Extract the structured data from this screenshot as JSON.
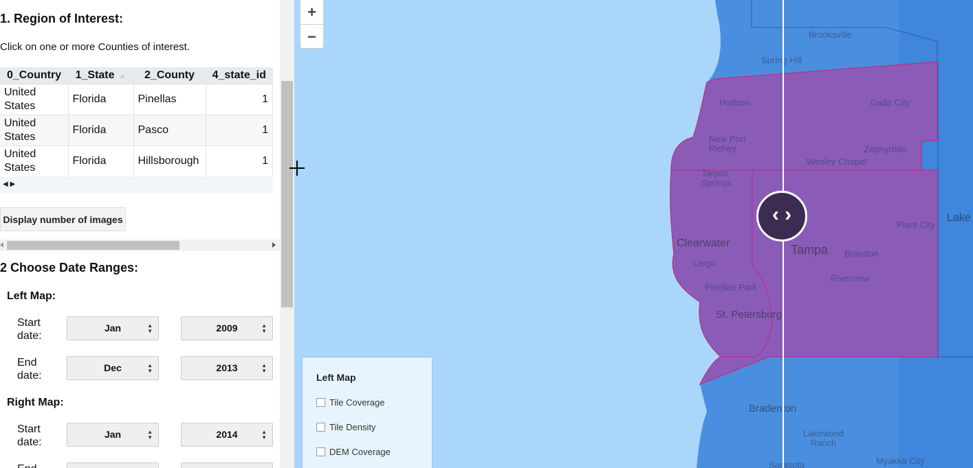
{
  "sidebar": {
    "region": {
      "title": "1. Region of Interest:",
      "instruction": "Click on one or more Counties of interest.",
      "table": {
        "columns": [
          "0_Country",
          "1_State",
          "2_County",
          "4_state_id"
        ],
        "rows": [
          {
            "country_line1": "United",
            "country_line2": "States",
            "state": "Florida",
            "county": "Pinellas",
            "state_id": "1"
          },
          {
            "country_line1": "United",
            "country_line2": "States",
            "state": "Florida",
            "county": "Pasco",
            "state_id": "1"
          },
          {
            "country_line1": "United",
            "country_line2": "States",
            "state": "Florida",
            "county": "Hillsborough",
            "state_id": "1"
          }
        ],
        "nav_arrows": "◀ ▶"
      },
      "count_button": "Display number of images"
    },
    "dates": {
      "title": "2 Choose Date Ranges:",
      "left_map_label": "Left Map:",
      "right_map_label": "Right Map:",
      "start_label_1": "Start",
      "start_label_2": "date:",
      "end_label_1": "End",
      "end_label_2": "date:",
      "left": {
        "start_month": "Jan",
        "start_year": "2009",
        "end_month": "Dec",
        "end_year": "2013"
      },
      "right": {
        "start_month": "Jan",
        "start_year": "2014",
        "end_month": "",
        "end_year": ""
      }
    }
  },
  "map": {
    "zoom_in": "+",
    "zoom_out": "−",
    "handle_glyph": "‹ ›",
    "legend": {
      "title": "Left Map",
      "options": [
        "Tile Coverage",
        "Tile Density",
        "DEM Coverage"
      ]
    },
    "places": {
      "brooksville": "Brooksville",
      "spring_hill": "Spring Hill",
      "hudson": "Hudson",
      "dade_city": "Dade City",
      "new_port_richey_1": "New Port",
      "new_port_richey_2": "Richey",
      "zephyrhills": "Zephyrhills",
      "wesley_chapel": "Wesley Chapel",
      "tarpon_springs_1": "Tarpon",
      "tarpon_springs_2": "Springs",
      "plant_city": "Plant City",
      "lake": "Lake",
      "clearwater": "Clearwater",
      "tampa": "Tampa",
      "brandon": "Brandon",
      "largo": "Largo",
      "pinellas_park": "Pinellas Park",
      "riverview": "Riverview",
      "st_petersburg": "St. Petersburg",
      "bradenton": "Bradenton",
      "lakewood_ranch_1": "Lakewood",
      "lakewood_ranch_2": "Ranch",
      "myakka_city": "Myakka City",
      "sarasota": "Sarasota"
    },
    "colors": {
      "water": "#aad6fb",
      "land": "#4a8ee0",
      "selected": "#8a5cb8",
      "handle": "#3c2c52"
    }
  }
}
